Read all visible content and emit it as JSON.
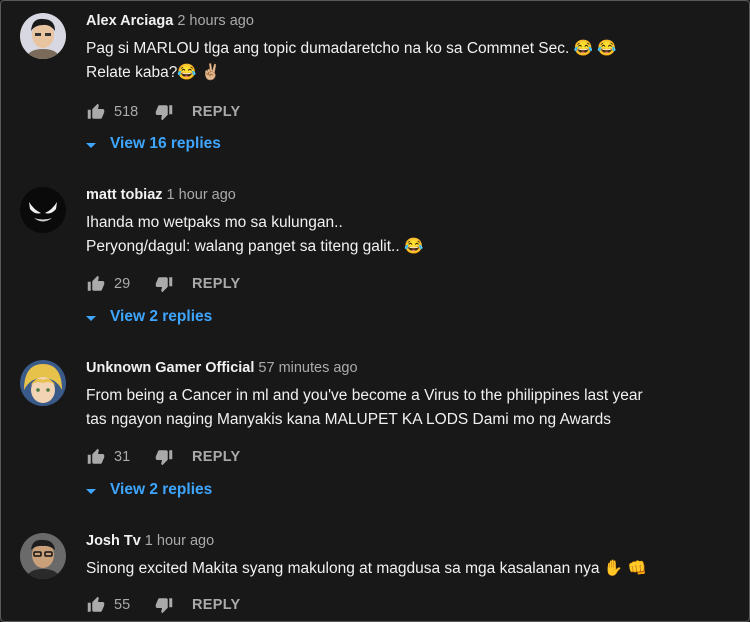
{
  "comments": [
    {
      "author": "Alex Arciaga",
      "time": "2 hours ago",
      "lines": [
        "Pag si MARLOU tlga ang topic dumadaretcho na ko sa Commnet Sec. 😂 😂",
        "Relate kaba?😂 ✌🏼"
      ],
      "likes": "518",
      "reply_label": "REPLY",
      "view_replies": "View 16 replies",
      "avatar_icon": "person-avatar-icon"
    },
    {
      "author": "matt tobiaz",
      "time": "1 hour ago",
      "lines": [
        "Ihanda mo wetpaks mo sa kulungan..",
        "Peryong/dagul: walang panget sa titeng galit.. 😂"
      ],
      "likes": "29",
      "reply_label": "REPLY",
      "view_replies": "View 2 replies",
      "avatar_icon": "venom-avatar-icon"
    },
    {
      "author": "Unknown Gamer Official",
      "time": "57 minutes ago",
      "lines": [
        "From being a Cancer in ml and you've become a Virus to the philippines last year",
        "tas ngayon naging Manyakis kana MALUPET KA LODS Dami mo ng Awards"
      ],
      "likes": "31",
      "reply_label": "REPLY",
      "view_replies": "View 2 replies",
      "avatar_icon": "anime-avatar-icon"
    },
    {
      "author": "Josh Tv",
      "time": "1 hour ago",
      "lines": [
        "Sinong excited Makita syang makulong at magdusa sa mga kasalanan nya ✋ 👊"
      ],
      "likes": "55",
      "reply_label": "REPLY",
      "view_replies": "",
      "avatar_icon": "person-glasses-avatar-icon"
    }
  ],
  "colors": {
    "background": "#181818",
    "text": "#f1f1f1",
    "secondary": "#aaaaaa",
    "link": "#3ea6ff"
  }
}
